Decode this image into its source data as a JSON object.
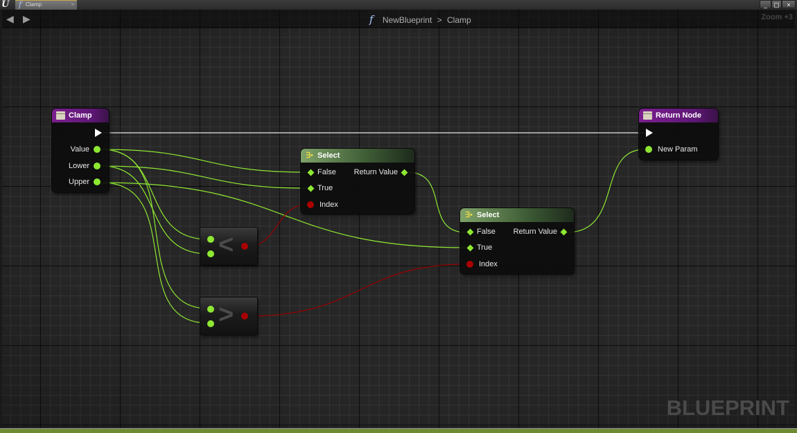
{
  "window": {
    "app_logo": "U",
    "tab": {
      "icon": "function-icon",
      "label": "Clamp",
      "close": "×"
    },
    "controls": {
      "minimize": "_",
      "maximize": "▢",
      "close": "×"
    }
  },
  "navbar": {
    "back": "◀",
    "forward": "▶",
    "breadcrumb": {
      "icon": "f",
      "parent": "NewBlueprint",
      "separator": ">",
      "current": "Clamp"
    },
    "zoom": "Zoom +3"
  },
  "watermark": "BLUEPRINT",
  "colors": {
    "float_pin": "#8ee832",
    "bool_pin": "#aa0000",
    "function_header": "#7a1f8f",
    "select_header": "#4f6e45",
    "exec_wire": "#c8c8c8"
  },
  "nodes": {
    "clamp": {
      "title": "Clamp",
      "pins": [
        "Value",
        "Lower",
        "Upper"
      ]
    },
    "select1": {
      "title": "Select",
      "inputs": [
        "False",
        "True",
        "Index"
      ],
      "output": "Return Value"
    },
    "select2": {
      "title": "Select",
      "inputs": [
        "False",
        "True",
        "Index"
      ],
      "output": "Return Value"
    },
    "less": {
      "symbol": "<"
    },
    "greater": {
      "symbol": ">"
    },
    "return": {
      "title": "Return Node",
      "pins": [
        "New Param"
      ]
    }
  }
}
